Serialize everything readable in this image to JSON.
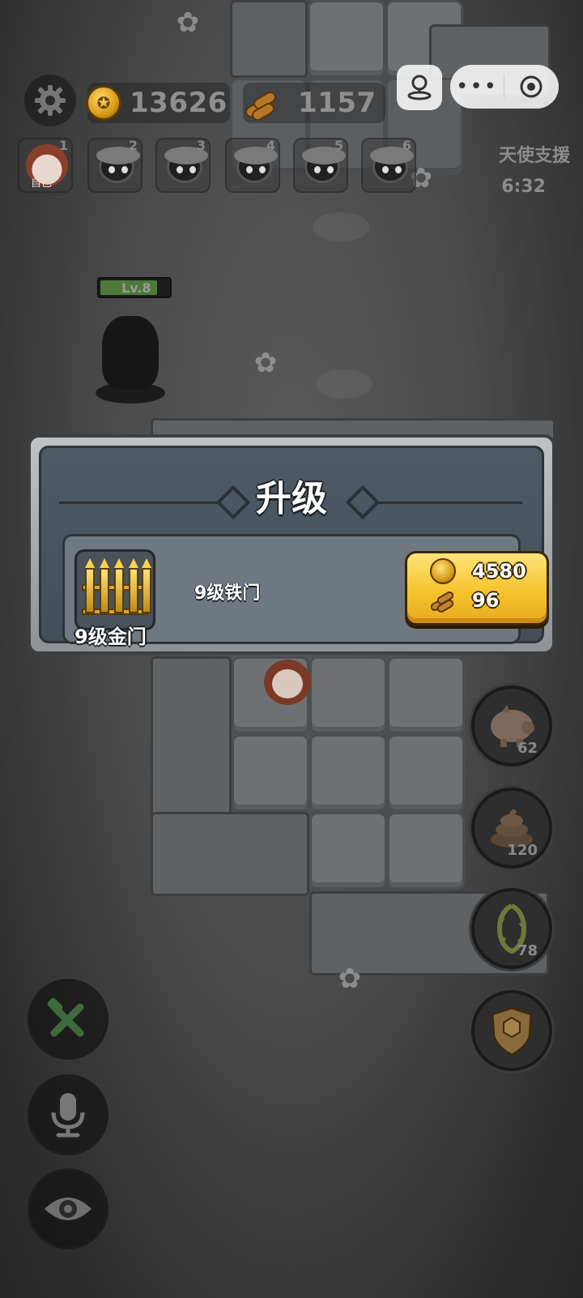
{
  "hud": {
    "coins": "13626",
    "wood": "1157"
  },
  "team": [
    {
      "num": "1",
      "label": "自己"
    },
    {
      "num": "2"
    },
    {
      "num": "3"
    },
    {
      "num": "4"
    },
    {
      "num": "5"
    },
    {
      "num": "6"
    }
  ],
  "angel_support": {
    "label": "天使支援",
    "timer": "6:32"
  },
  "enemy": {
    "level": "Lv.8"
  },
  "dialog": {
    "title": "升级",
    "gate_label": "9级金门",
    "gate_name": "9级铁门",
    "cost_gold": "4580",
    "cost_wood": "96"
  },
  "skills": [
    {
      "icon": "piggy-bank-icon",
      "count": "62"
    },
    {
      "icon": "poop-icon",
      "count": "120"
    },
    {
      "icon": "thorns-icon",
      "count": "78"
    },
    {
      "icon": "shield-icon",
      "count": ""
    }
  ],
  "left_buttons": [
    {
      "icon": "wrench-hammer-icon"
    },
    {
      "icon": "microphone-icon"
    },
    {
      "icon": "eye-icon"
    }
  ],
  "colors": {
    "gold_button": "#f5c42d",
    "dialog_bg": "#4f5a66",
    "coin": "#d79a17"
  }
}
